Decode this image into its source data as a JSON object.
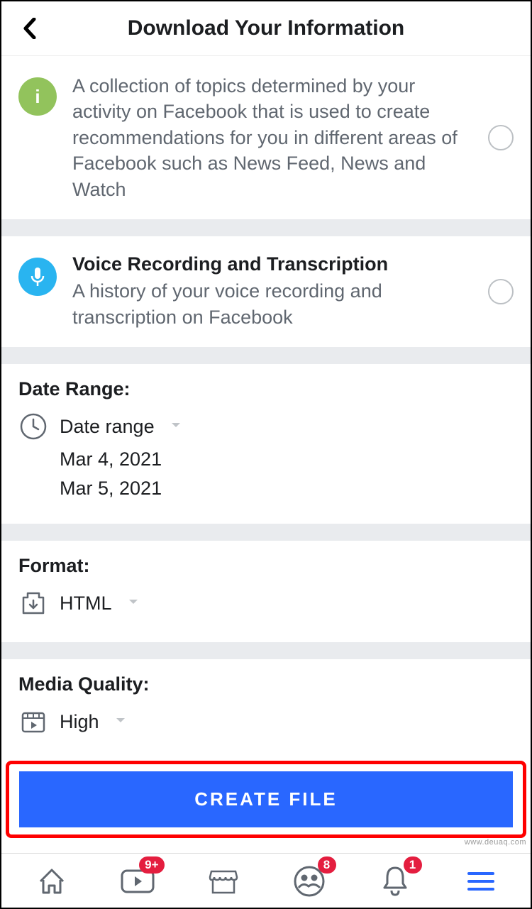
{
  "header": {
    "title": "Download Your Information"
  },
  "items": [
    {
      "description": "A collection of topics determined by your activity on Facebook that is used to create recommendations for you in different areas of Facebook such as News Feed, News and Watch",
      "icon_letter": "i"
    },
    {
      "title": "Voice Recording and Transcription",
      "description": "A history of your voice recording and transcription on Facebook"
    }
  ],
  "date_range": {
    "label": "Date Range:",
    "selector_label": "Date range",
    "start": "Mar 4, 2021",
    "end": "Mar 5, 2021"
  },
  "format": {
    "label": "Format:",
    "value": "HTML"
  },
  "media_quality": {
    "label": "Media Quality:",
    "value": "High"
  },
  "create_button": "CREATE FILE",
  "bottom_nav": {
    "watch_badge": "9+",
    "groups_badge": "8",
    "notifications_badge": "1"
  },
  "watermark": "www.deuaq.com"
}
